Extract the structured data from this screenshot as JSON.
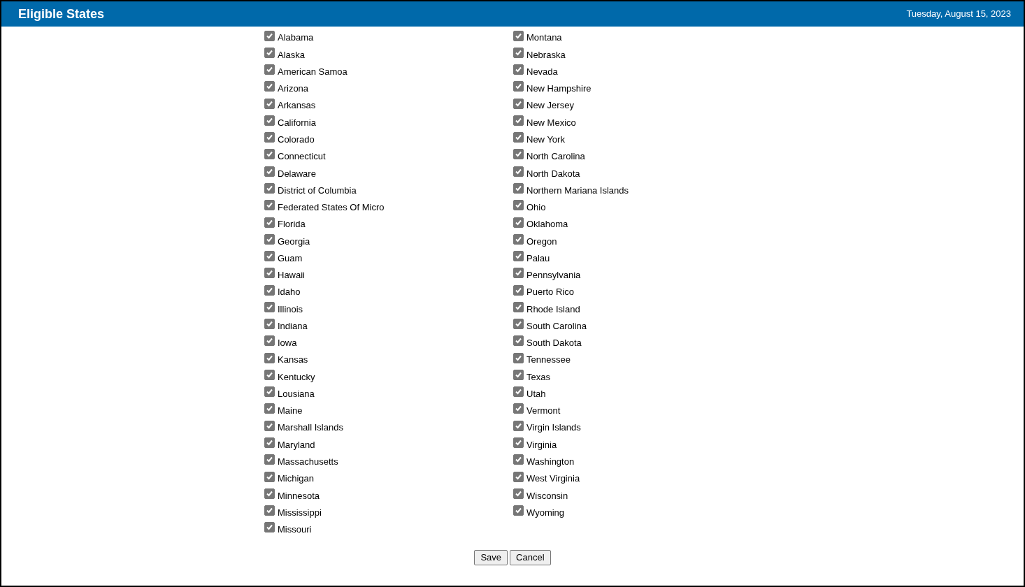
{
  "header": {
    "title": "Eligible States",
    "date": "Tuesday, August 15, 2023"
  },
  "columns": [
    [
      {
        "label": "Alabama",
        "checked": true,
        "disabled": true
      },
      {
        "label": "Alaska",
        "checked": true,
        "disabled": true
      },
      {
        "label": "American Samoa",
        "checked": true,
        "disabled": true
      },
      {
        "label": "Arizona",
        "checked": true,
        "disabled": true
      },
      {
        "label": "Arkansas",
        "checked": true,
        "disabled": true
      },
      {
        "label": "California",
        "checked": true,
        "disabled": true
      },
      {
        "label": "Colorado",
        "checked": true,
        "disabled": true
      },
      {
        "label": "Connecticut",
        "checked": true,
        "disabled": true
      },
      {
        "label": "Delaware",
        "checked": true,
        "disabled": true
      },
      {
        "label": "District of Columbia",
        "checked": true,
        "disabled": true
      },
      {
        "label": "Federated States Of Micro",
        "checked": true,
        "disabled": true
      },
      {
        "label": "Florida",
        "checked": true,
        "disabled": true
      },
      {
        "label": "Georgia",
        "checked": true,
        "disabled": true
      },
      {
        "label": "Guam",
        "checked": true,
        "disabled": true
      },
      {
        "label": "Hawaii",
        "checked": true,
        "disabled": true
      },
      {
        "label": "Idaho",
        "checked": true,
        "disabled": true
      },
      {
        "label": "Illinois",
        "checked": true,
        "disabled": true
      },
      {
        "label": "Indiana",
        "checked": true,
        "disabled": true
      },
      {
        "label": "Iowa",
        "checked": true,
        "disabled": true
      },
      {
        "label": "Kansas",
        "checked": true,
        "disabled": true
      },
      {
        "label": "Kentucky",
        "checked": true,
        "disabled": true
      },
      {
        "label": "Lousiana",
        "checked": true,
        "disabled": true
      },
      {
        "label": "Maine",
        "checked": true,
        "disabled": true
      },
      {
        "label": "Marshall Islands",
        "checked": true,
        "disabled": true
      },
      {
        "label": "Maryland",
        "checked": true,
        "disabled": true
      },
      {
        "label": "Massachusetts",
        "checked": true,
        "disabled": true
      },
      {
        "label": "Michigan",
        "checked": true,
        "disabled": true
      },
      {
        "label": "Minnesota",
        "checked": true,
        "disabled": true
      },
      {
        "label": "Mississippi",
        "checked": true,
        "disabled": true
      },
      {
        "label": "Missouri",
        "checked": true,
        "disabled": true
      }
    ],
    [
      {
        "label": "Montana",
        "checked": true,
        "disabled": true
      },
      {
        "label": "Nebraska",
        "checked": true,
        "disabled": true
      },
      {
        "label": "Nevada",
        "checked": true,
        "disabled": true
      },
      {
        "label": "New Hampshire",
        "checked": true,
        "disabled": true
      },
      {
        "label": "New Jersey",
        "checked": true,
        "disabled": true
      },
      {
        "label": "New Mexico",
        "checked": true,
        "disabled": true
      },
      {
        "label": "New York",
        "checked": true,
        "disabled": true
      },
      {
        "label": "North Carolina",
        "checked": true,
        "disabled": true
      },
      {
        "label": "North Dakota",
        "checked": true,
        "disabled": true
      },
      {
        "label": "Northern Mariana Islands",
        "checked": true,
        "disabled": true
      },
      {
        "label": "Ohio",
        "checked": true,
        "disabled": true
      },
      {
        "label": "Oklahoma",
        "checked": true,
        "disabled": true
      },
      {
        "label": "Oregon",
        "checked": true,
        "disabled": true
      },
      {
        "label": "Palau",
        "checked": true,
        "disabled": true
      },
      {
        "label": "Pennsylvania",
        "checked": true,
        "disabled": true
      },
      {
        "label": "Puerto Rico",
        "checked": true,
        "disabled": true
      },
      {
        "label": "Rhode Island",
        "checked": true,
        "disabled": true
      },
      {
        "label": "South Carolina",
        "checked": true,
        "disabled": true
      },
      {
        "label": "South Dakota",
        "checked": true,
        "disabled": true
      },
      {
        "label": "Tennessee",
        "checked": true,
        "disabled": true
      },
      {
        "label": "Texas",
        "checked": true,
        "disabled": true
      },
      {
        "label": "Utah",
        "checked": true,
        "disabled": true
      },
      {
        "label": "Vermont",
        "checked": true,
        "disabled": true
      },
      {
        "label": "Virgin Islands",
        "checked": true,
        "disabled": true
      },
      {
        "label": "Virginia",
        "checked": true,
        "disabled": true
      },
      {
        "label": "Washington",
        "checked": true,
        "disabled": true
      },
      {
        "label": "West Virginia",
        "checked": true,
        "disabled": true
      },
      {
        "label": "Wisconsin",
        "checked": true,
        "disabled": true
      },
      {
        "label": "Wyoming",
        "checked": true,
        "disabled": true
      }
    ]
  ],
  "buttons": [
    "Save",
    "Cancel"
  ]
}
